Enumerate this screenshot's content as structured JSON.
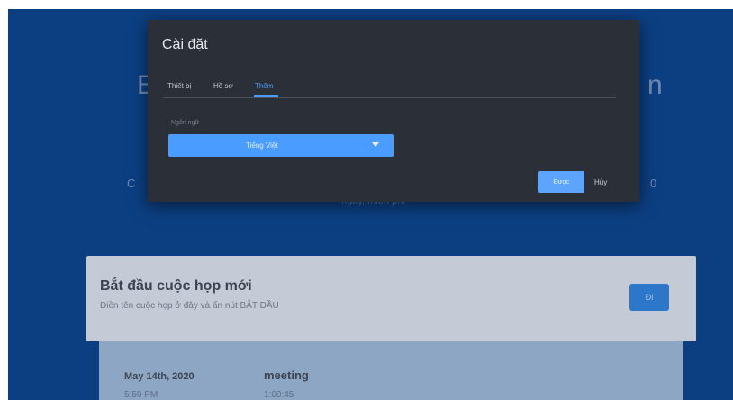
{
  "background": {
    "title_left_fragment": "B",
    "title_right_fragment": "n",
    "left_fragment": "C",
    "right_fragment": "0",
    "subtitle": "ngay, miễn phí"
  },
  "start_card": {
    "title": "Bắt đầu cuộc họp mới",
    "description": "Điền tên cuộc họp ở đây và ấn nút BẮT ĐẦU",
    "button_label": "Đi"
  },
  "history": {
    "date": "May 14th, 2020",
    "time": "5:59 PM",
    "meeting_name": "meeting",
    "duration": "1:00:45"
  },
  "dialog": {
    "title": "Cài đặt",
    "tabs": [
      "Thiết bị",
      "Hồ sơ",
      "Thêm"
    ],
    "active_tab": 2,
    "language_label": "Ngôn ngữ",
    "language_value": "Tiếng Việt",
    "ok_label": "Được",
    "cancel_label": "Hủy"
  },
  "colors": {
    "accent": "#4a9dff",
    "dialog_bg": "#2b2f38",
    "page_bg": "#0c3f82"
  }
}
